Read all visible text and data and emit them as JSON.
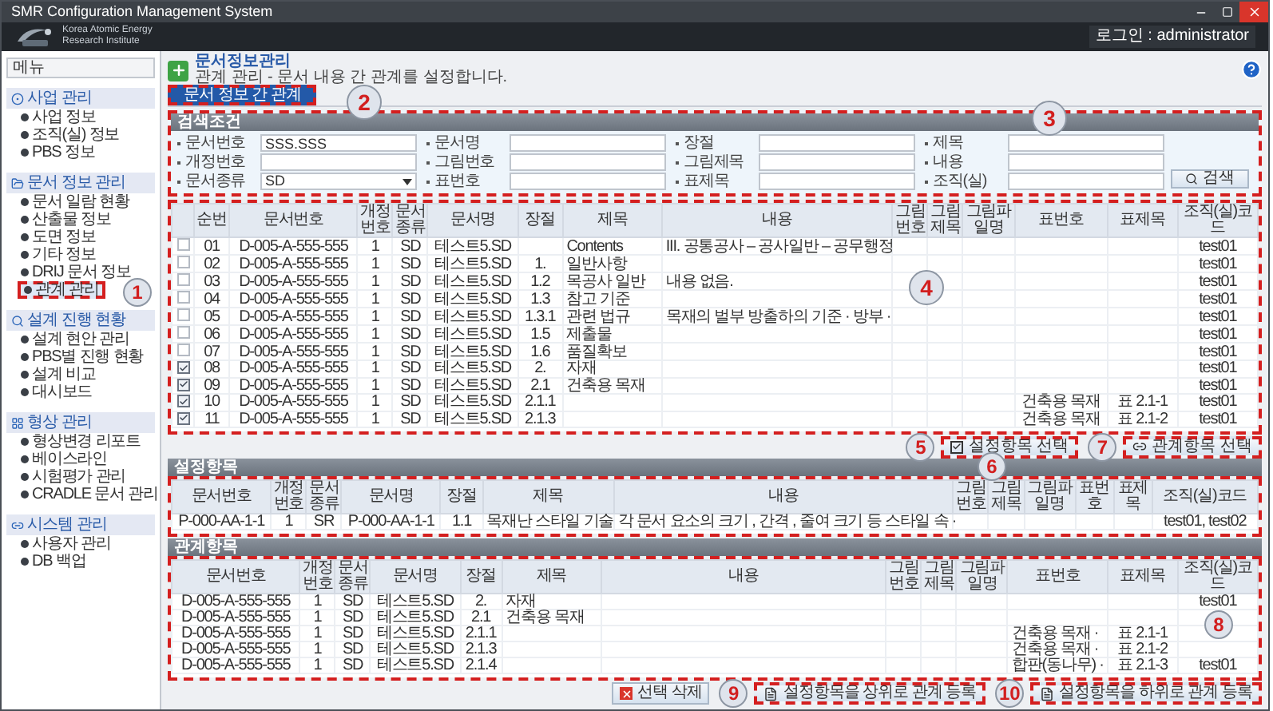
{
  "window": {
    "title": "SMR Configuration Management System"
  },
  "header": {
    "org_line_1": "Korea Atomic Energy",
    "org_line_2": "Research Institute",
    "login": "로그인 : administrator"
  },
  "sidebar": {
    "title": "메뉴",
    "callout": "1",
    "groups": [
      {
        "label": "사업 관리",
        "items": [
          {
            "label": "사업 정보",
            "selected": false
          },
          {
            "label": "조직(실) 정보",
            "selected": false
          },
          {
            "label": "PBS 정보",
            "selected": false
          }
        ]
      },
      {
        "label": "문서 정보 관리",
        "items": [
          {
            "label": "문서 일람 현황",
            "selected": false
          },
          {
            "label": "산출물 정보",
            "selected": false
          },
          {
            "label": "도면 정보",
            "selected": false
          },
          {
            "label": "기타 정보",
            "selected": false
          },
          {
            "label": "DRIJ 문서 정보",
            "selected": false
          },
          {
            "label": "관계 관리",
            "selected": true
          }
        ]
      },
      {
        "label": "설계 진행 현황",
        "items": [
          {
            "label": "설계 현안 관리",
            "selected": false
          },
          {
            "label": "PBS별 진행 현황",
            "selected": false
          },
          {
            "label": "설계 비교",
            "selected": false
          },
          {
            "label": "대시보드",
            "selected": false
          }
        ]
      },
      {
        "label": "형상 관리",
        "items": [
          {
            "label": "형상변경 리포트",
            "selected": false
          },
          {
            "label": "베이스라인",
            "selected": false
          },
          {
            "label": "시험평가 관리",
            "selected": false
          },
          {
            "label": "CRADLE 문서 관리",
            "selected": false
          }
        ]
      },
      {
        "label": "시스템 관리",
        "items": [
          {
            "label": "사용자 관리",
            "selected": false
          },
          {
            "label": "DB 백업",
            "selected": false
          }
        ]
      }
    ]
  },
  "page": {
    "title": "문서정보관리",
    "subtitle": "관계 관리 - 문서 내용 간 관계를 설정합니다."
  },
  "tabs": {
    "callout": "2",
    "items": [
      {
        "label": "문서 정보 간 관계",
        "selected": true
      }
    ]
  },
  "search": {
    "title": "검색조건",
    "callout": "3",
    "button": "검색",
    "fields": [
      {
        "label": "문서번호",
        "kind": "text",
        "value": "SSS.SSS"
      },
      {
        "label": "문서명",
        "kind": "text"
      },
      {
        "label": "장절",
        "kind": "text"
      },
      {
        "label": "제목",
        "kind": "text"
      },
      {
        "label": "개정번호",
        "kind": "text"
      },
      {
        "label": "그림번호",
        "kind": "text"
      },
      {
        "label": "그림제목",
        "kind": "text"
      },
      {
        "label": "내용",
        "kind": "text"
      },
      {
        "label": "문서종류",
        "kind": "select",
        "value": "SD"
      },
      {
        "label": "표번호",
        "kind": "text"
      },
      {
        "label": "표제목",
        "kind": "text"
      },
      {
        "label": "조직(실)",
        "kind": "text"
      }
    ]
  },
  "document_table": {
    "callout": "4",
    "columns": [
      "순번",
      "문서번호",
      "개정번호",
      "문서종류",
      "문서명",
      "장절",
      "제목",
      "내용",
      "그림번호",
      "그림제목",
      "그림파일명",
      "표번호",
      "표제목",
      "조직(실)코드"
    ],
    "rows": [
      {
        "checked": false,
        "cells": [
          "01",
          "D-005-A-555-555",
          "1",
          "SD",
          "테스트5.SD",
          null,
          "Contents",
          "III. 공통공사 – 공사일반 – 공무행정",
          null,
          null,
          null,
          null,
          null,
          "test01"
        ]
      },
      {
        "checked": false,
        "cells": [
          "02",
          "D-005-A-555-555",
          "1",
          "SD",
          "테스트5.SD",
          "1.",
          "일반사항",
          null,
          null,
          null,
          null,
          null,
          null,
          "test01"
        ]
      },
      {
        "checked": false,
        "cells": [
          "03",
          "D-005-A-555-555",
          "1",
          "SD",
          "테스트5.SD",
          "1.2",
          "목공사 일반",
          "내용 없음.",
          null,
          null,
          null,
          null,
          null,
          "test01"
        ]
      },
      {
        "checked": false,
        "cells": [
          "04",
          "D-005-A-555-555",
          "1",
          "SD",
          "테스트5.SD",
          "1.3",
          "참고 기준",
          null,
          null,
          null,
          null,
          null,
          null,
          "test01"
        ]
      },
      {
        "checked": false,
        "cells": [
          "05",
          "D-005-A-555-555",
          "1",
          "SD",
          "테스트5.SD",
          "1.3.1",
          "관련 법규",
          "목재의 벌부 방출하의 기준 · 방부 ·",
          null,
          null,
          null,
          null,
          null,
          "test01"
        ]
      },
      {
        "checked": false,
        "cells": [
          "06",
          "D-005-A-555-555",
          "1",
          "SD",
          "테스트5.SD",
          "1.5",
          "제출물",
          null,
          null,
          null,
          null,
          null,
          null,
          "test01"
        ]
      },
      {
        "checked": false,
        "cells": [
          "07",
          "D-005-A-555-555",
          "1",
          "SD",
          "테스트5.SD",
          "1.6",
          "품질확보",
          null,
          null,
          null,
          null,
          null,
          null,
          "test01"
        ]
      },
      {
        "checked": true,
        "cells": [
          "08",
          "D-005-A-555-555",
          "1",
          "SD",
          "테스트5.SD",
          "2.",
          "자재",
          null,
          null,
          null,
          null,
          null,
          null,
          "test01"
        ]
      },
      {
        "checked": true,
        "cells": [
          "09",
          "D-005-A-555-555",
          "1",
          "SD",
          "테스트5.SD",
          "2.1",
          "건축용 목재",
          null,
          null,
          null,
          null,
          null,
          null,
          "test01"
        ]
      },
      {
        "checked": true,
        "cells": [
          "10",
          "D-005-A-555-555",
          "1",
          "SD",
          "테스트5.SD",
          "2.1.1",
          null,
          null,
          null,
          null,
          null,
          "건축용 목재",
          "표 2.1-1",
          "test01"
        ]
      },
      {
        "checked": true,
        "cells": [
          "11",
          "D-005-A-555-555",
          "1",
          "SD",
          "테스트5.SD",
          "2.1.3",
          null,
          null,
          null,
          null,
          null,
          "건축용 목재",
          "표 2.1-2",
          "test01"
        ]
      }
    ]
  },
  "actions": [
    {
      "label": "설정항목 선택",
      "kind": "check",
      "callout": "5"
    },
    {
      "label": "관계항목 선택",
      "kind": "link",
      "callout": "7"
    }
  ],
  "setting_table": {
    "title": "설정항목",
    "callout": "6",
    "columns": [
      "문서번호",
      "개정번호",
      "문서종류",
      "문서명",
      "장절",
      "제목",
      "내용",
      "그림번호",
      "그림제목",
      "그림파일명",
      "표번호",
      "표제목",
      "조직(실)코드"
    ],
    "rows": [
      {
        "cells": [
          "P-000-AA-1-1",
          "1",
          "SR",
          "P-000-AA-1-1",
          "1.1",
          "목재난 스타일 기술",
          "각 문서 요소의 크기 , 간격 , 줄여 크기 등 스타일 속 ·",
          null,
          null,
          null,
          null,
          null,
          "test01, test02"
        ]
      }
    ]
  },
  "relation_table": {
    "title": "관계항목",
    "callout": "8",
    "columns": [
      "문서번호",
      "개정번호",
      "문서종류",
      "문서명",
      "장절",
      "제목",
      "내용",
      "그림번호",
      "그림제목",
      "그림파일명",
      "표번호",
      "표제목",
      "조직(실)코드"
    ],
    "rows": [
      {
        "cells": [
          "D-005-A-555-555",
          "1",
          "SD",
          "테스트5.SD",
          "2.",
          "자재",
          null,
          null,
          null,
          null,
          null,
          null,
          "test01"
        ]
      },
      {
        "cells": [
          "D-005-A-555-555",
          "1",
          "SD",
          "테스트5.SD",
          "2.1",
          "건축용 목재",
          null,
          null,
          null,
          null,
          null,
          null,
          null
        ]
      },
      {
        "cells": [
          "D-005-A-555-555",
          "1",
          "SD",
          "테스트5.SD",
          "2.1.1",
          null,
          null,
          null,
          null,
          null,
          "건축용 목재 ·",
          "표 2.1-1",
          null
        ]
      },
      {
        "cells": [
          "D-005-A-555-555",
          "1",
          "SD",
          "테스트5.SD",
          "2.1.3",
          null,
          null,
          null,
          null,
          null,
          "건축용 목재 ·",
          "표 2.1-2",
          null
        ]
      },
      {
        "cells": [
          "D-005-A-555-555",
          "1",
          "SD",
          "테스트5.SD",
          "2.1.4",
          null,
          null,
          null,
          null,
          null,
          "합판(동나무) ·",
          "표 2.1-3",
          "test01"
        ]
      }
    ]
  },
  "bottom_buttons": [
    {
      "label": "선택 삭제",
      "kind": "delete"
    },
    {
      "label": "설정항목을 상위로 관계 등록",
      "kind": "upper",
      "callout": "9"
    },
    {
      "label": "설정항목을 하위로 관계 등록",
      "kind": "lower",
      "callout": "10"
    }
  ]
}
